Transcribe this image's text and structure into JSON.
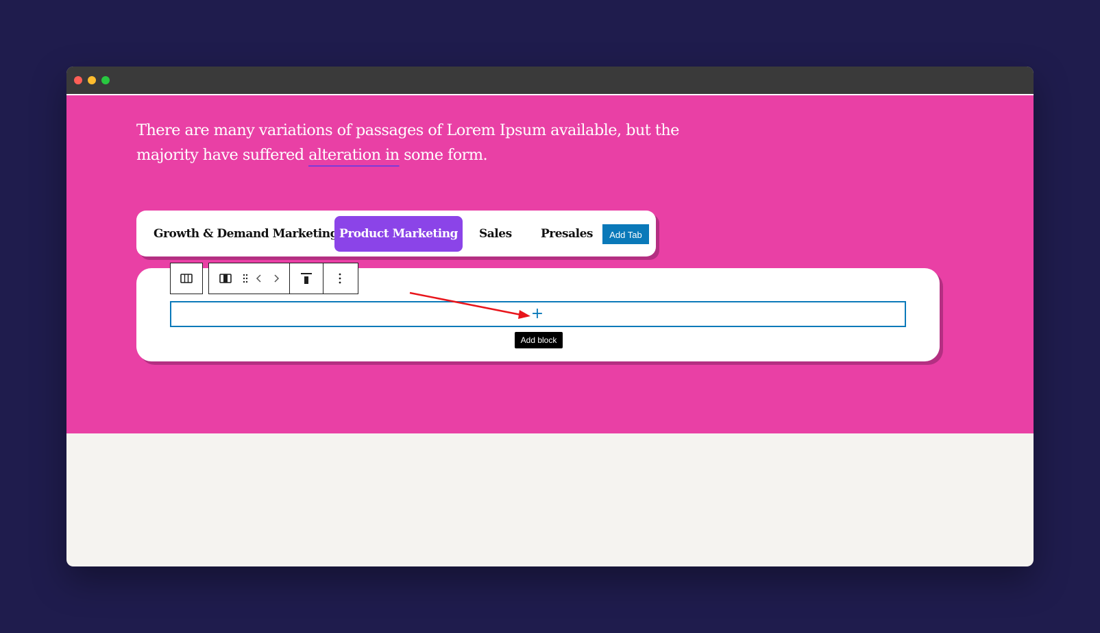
{
  "hero": {
    "intro_before": "There are many variations of passages of Lorem Ipsum available, but the majority have suffered ",
    "intro_link": "alteration in",
    "intro_after": " some form."
  },
  "tabs": [
    {
      "label": "Growth & Demand Marketing",
      "active": false
    },
    {
      "label": "Product Marketing",
      "active": true
    },
    {
      "label": "Sales",
      "active": false
    },
    {
      "label": "Presales",
      "active": false
    }
  ],
  "add_tab_label": "Add Tab",
  "toolbar": {
    "icons": [
      "columns-icon",
      "column-icon",
      "drag-handle-icon",
      "move-left-icon",
      "move-right-icon",
      "align-top-icon",
      "more-options-icon"
    ]
  },
  "add_block": {
    "symbol": "+",
    "tooltip": "Add block"
  },
  "colors": {
    "background": "#1f1c4d",
    "hero": "#e940a5",
    "active_tab": "#8b44e8",
    "accent": "#0a79b9",
    "annotation_arrow": "#e8151b"
  }
}
